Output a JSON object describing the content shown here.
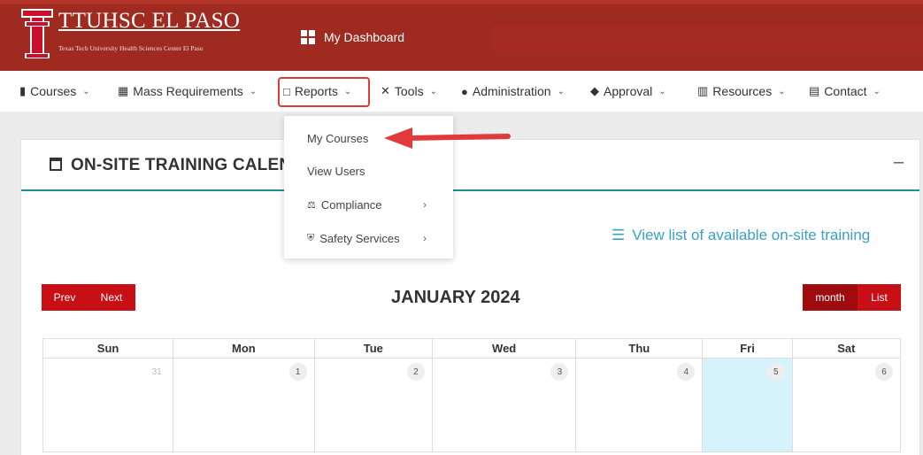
{
  "header": {
    "brand_title": "TTUHSC EL PASO",
    "brand_subtitle": "Texas Tech University Health Sciences Center El Paso",
    "dashboard_label": "My Dashboard"
  },
  "nav": {
    "items": [
      {
        "label": "Courses",
        "icon": "tag-icon"
      },
      {
        "label": "Mass Requirements",
        "icon": "book-icon"
      },
      {
        "label": "Reports",
        "icon": "monitor-icon"
      },
      {
        "label": "Tools",
        "icon": "tools-icon"
      },
      {
        "label": "Administration",
        "icon": "users-icon"
      },
      {
        "label": "Approval",
        "icon": "handshake-icon"
      },
      {
        "label": "Resources",
        "icon": "library-icon"
      },
      {
        "label": "Contact",
        "icon": "building-icon"
      }
    ]
  },
  "dropdown": {
    "items": [
      {
        "label": "My Courses"
      },
      {
        "label": "View Users"
      },
      {
        "label": "Compliance",
        "icon": "scale-icon",
        "has_submenu": true
      },
      {
        "label": "Safety Services",
        "icon": "shield-icon",
        "has_submenu": true
      }
    ]
  },
  "card": {
    "title": "ON-SITE TRAINING CALENDAR",
    "collapse_symbol": "–",
    "view_list_label": "View list of available on-site training"
  },
  "calendar": {
    "prev_label": "Prev",
    "next_label": "Next",
    "month_label": "month",
    "list_label": "List",
    "title": "JANUARY 2024",
    "weekdays": [
      "Sun",
      "Mon",
      "Tue",
      "Wed",
      "Thu",
      "Fri",
      "Sat"
    ],
    "days": [
      "31",
      "1",
      "2",
      "3",
      "4",
      "5",
      "6"
    ]
  },
  "colors": {
    "header_red": "#9e2a20",
    "button_red": "#c80f16",
    "accent_teal": "#1c8f9a",
    "link_blue": "#3aa0c8",
    "today_bg": "#d6f2fa",
    "annotation_red": "#e03a3a"
  }
}
